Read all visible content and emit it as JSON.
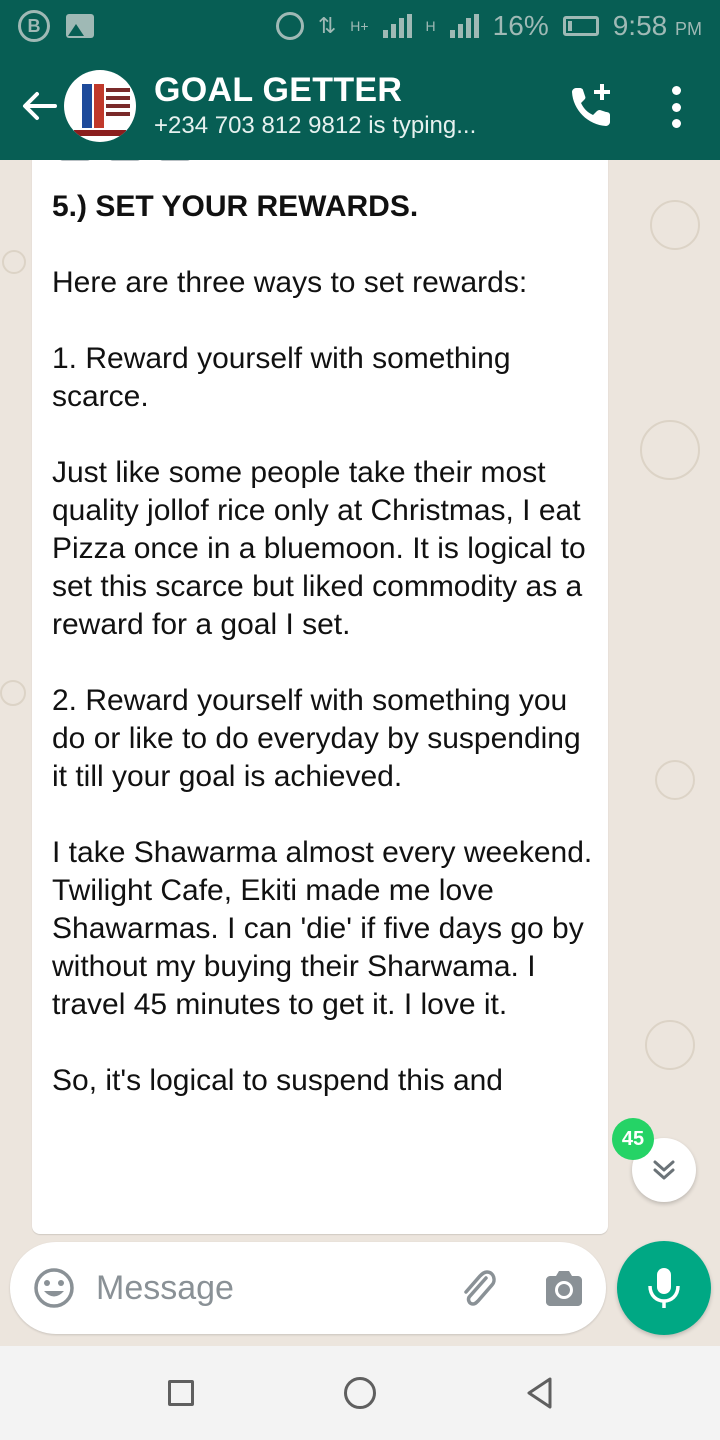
{
  "status_bar": {
    "battery": "16%",
    "time": "9:58",
    "ampm": "PM",
    "network_a": "H+",
    "network_b": "H"
  },
  "header": {
    "title": "GOAL GETTER",
    "subtitle": "+234 703 812 9812 is typing..."
  },
  "message": {
    "heading": "5.) SET YOUR REWARDS.",
    "paragraphs": [
      "Here are three ways to set rewards:",
      "1. Reward yourself with something scarce.",
      "Just like some people take their most quality jollof rice only at Christmas, I eat Pizza once in a bluemoon. It is logical to set this scarce but liked commodity as a reward for a goal I set.",
      "2. Reward yourself with something you do or like to do everyday by suspending it till your goal is achieved.",
      "I take Shawarma almost every weekend. Twilight Cafe, Ekiti made me love Shawarmas. I can 'die' if five days go by without my buying their Sharwama. I travel 45 minutes to get it. I love it.",
      "So, it's logical to suspend this and"
    ]
  },
  "unread_count": "45",
  "composer": {
    "placeholder": "Message"
  },
  "colors": {
    "header": "#075E54",
    "chat_bg": "#ECE5DD",
    "accent": "#00A884",
    "badge": "#25D366"
  },
  "icons": [
    "back-arrow-icon",
    "add-call-icon",
    "more-vert-icon",
    "emoji-icon",
    "attach-icon",
    "camera-icon",
    "mic-icon",
    "chevron-down-icon"
  ]
}
